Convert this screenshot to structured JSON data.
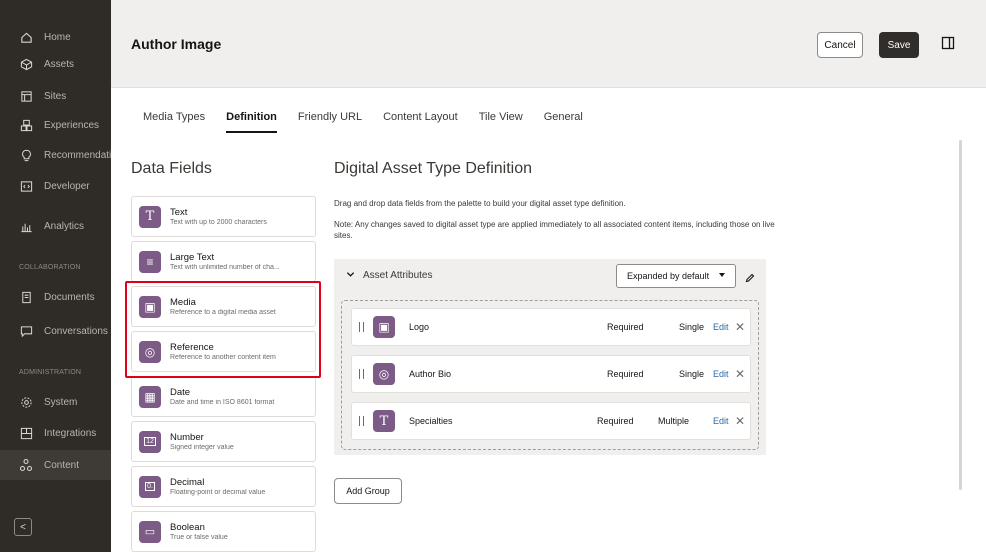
{
  "sidebar": {
    "items": [
      {
        "label": "Home",
        "icon": "home-icon"
      },
      {
        "label": "Assets",
        "icon": "assets-icon"
      },
      {
        "label": "Sites",
        "icon": "sites-icon"
      },
      {
        "label": "Experiences",
        "icon": "experiences-icon"
      },
      {
        "label": "Recommendations",
        "icon": "recommendations-icon"
      },
      {
        "label": "Developer",
        "icon": "developer-icon"
      },
      {
        "label": "Analytics",
        "icon": "analytics-icon"
      }
    ],
    "collab_heading": "COLLABORATION",
    "collab_items": [
      {
        "label": "Documents",
        "icon": "documents-icon"
      },
      {
        "label": "Conversations",
        "icon": "conversations-icon"
      }
    ],
    "admin_heading": "ADMINISTRATION",
    "admin_items": [
      {
        "label": "System",
        "icon": "system-icon"
      },
      {
        "label": "Integrations",
        "icon": "integrations-icon"
      },
      {
        "label": "Content",
        "icon": "content-icon"
      }
    ],
    "collapse_label": "<"
  },
  "header": {
    "title": "Author Image",
    "cancel_label": "Cancel",
    "save_label": "Save"
  },
  "tabs": [
    "Media Types",
    "Definition",
    "Friendly URL",
    "Content Layout",
    "Tile View",
    "General"
  ],
  "active_tab": "Definition",
  "data_fields": {
    "title": "Data Fields",
    "items": [
      {
        "name": "Text",
        "desc": "Text with up to 2000 characters",
        "glyph": "T"
      },
      {
        "name": "Large Text",
        "desc": "Text with unlimited number of cha...",
        "glyph": "≡"
      },
      {
        "name": "Media",
        "desc": "Reference to a digital media asset",
        "glyph": "▣"
      },
      {
        "name": "Reference",
        "desc": "Reference to another content item",
        "glyph": "◎"
      },
      {
        "name": "Date",
        "desc": "Date and time in ISO 8601 format",
        "glyph": "▦"
      },
      {
        "name": "Number",
        "desc": "Signed integer value",
        "glyph": "12"
      },
      {
        "name": "Decimal",
        "desc": "Floating-point or decimal value",
        "glyph": "0."
      },
      {
        "name": "Boolean",
        "desc": "True or false value",
        "glyph": "▭"
      }
    ]
  },
  "definition": {
    "title": "Digital Asset Type Definition",
    "desc": "Drag and drop data fields from the palette to build your digital asset type definition.",
    "note": "Note: Any changes saved to digital asset type are applied immediately to all associated content items, including those on live sites.",
    "section_label": "Asset Attributes",
    "expand_select": "Expanded by default",
    "rows": [
      {
        "name": "Logo",
        "required": "Required",
        "cardinality": "Single",
        "edit": "Edit",
        "glyph": "▣"
      },
      {
        "name": "Author Bio",
        "required": "Required",
        "cardinality": "Single",
        "edit": "Edit",
        "glyph": "◎"
      },
      {
        "name": "Specialties",
        "required": "Required",
        "cardinality": "Multiple",
        "edit": "Edit",
        "glyph": "T"
      }
    ],
    "add_group_label": "Add Group"
  },
  "colors": {
    "sidebar_bg": "#2f2b27",
    "field_icon_bg": "#7c5b86",
    "highlight": "#e0001b",
    "link": "#2a6aa6"
  }
}
